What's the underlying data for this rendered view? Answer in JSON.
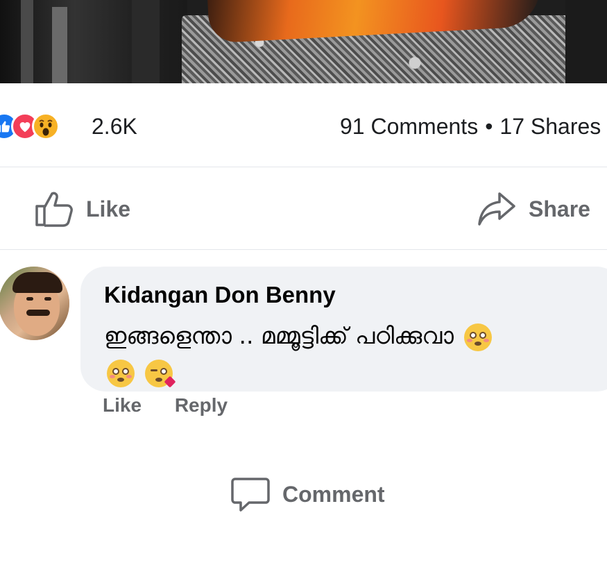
{
  "post": {
    "reaction_count": "2.6K",
    "comments_text": "91 Comments",
    "separator": "•",
    "shares_text": "17 Shares"
  },
  "actions": {
    "like": "Like",
    "comment": "Comment",
    "share": "Share"
  },
  "comment": {
    "author": "Kidangan Don Benny",
    "text": "ഇങ്ങളെന്താ .. മമ്മൂട്ടിക്ക് പഠിക്കുവാ",
    "footer_like": "Like",
    "footer_reply": "Reply"
  },
  "icons": [
    "like-reaction-icon",
    "love-reaction-icon",
    "wow-reaction-icon",
    "thumbs-up-icon",
    "comment-bubble-icon",
    "share-arrow-icon",
    "flushed-emoji",
    "kiss-emoji"
  ],
  "colors": {
    "like_blue": "#1877f2",
    "love_red": "#f33e58",
    "wow_yellow": "#f7b125",
    "action_gray": "#65676b",
    "bubble_bg": "#f0f2f5"
  }
}
